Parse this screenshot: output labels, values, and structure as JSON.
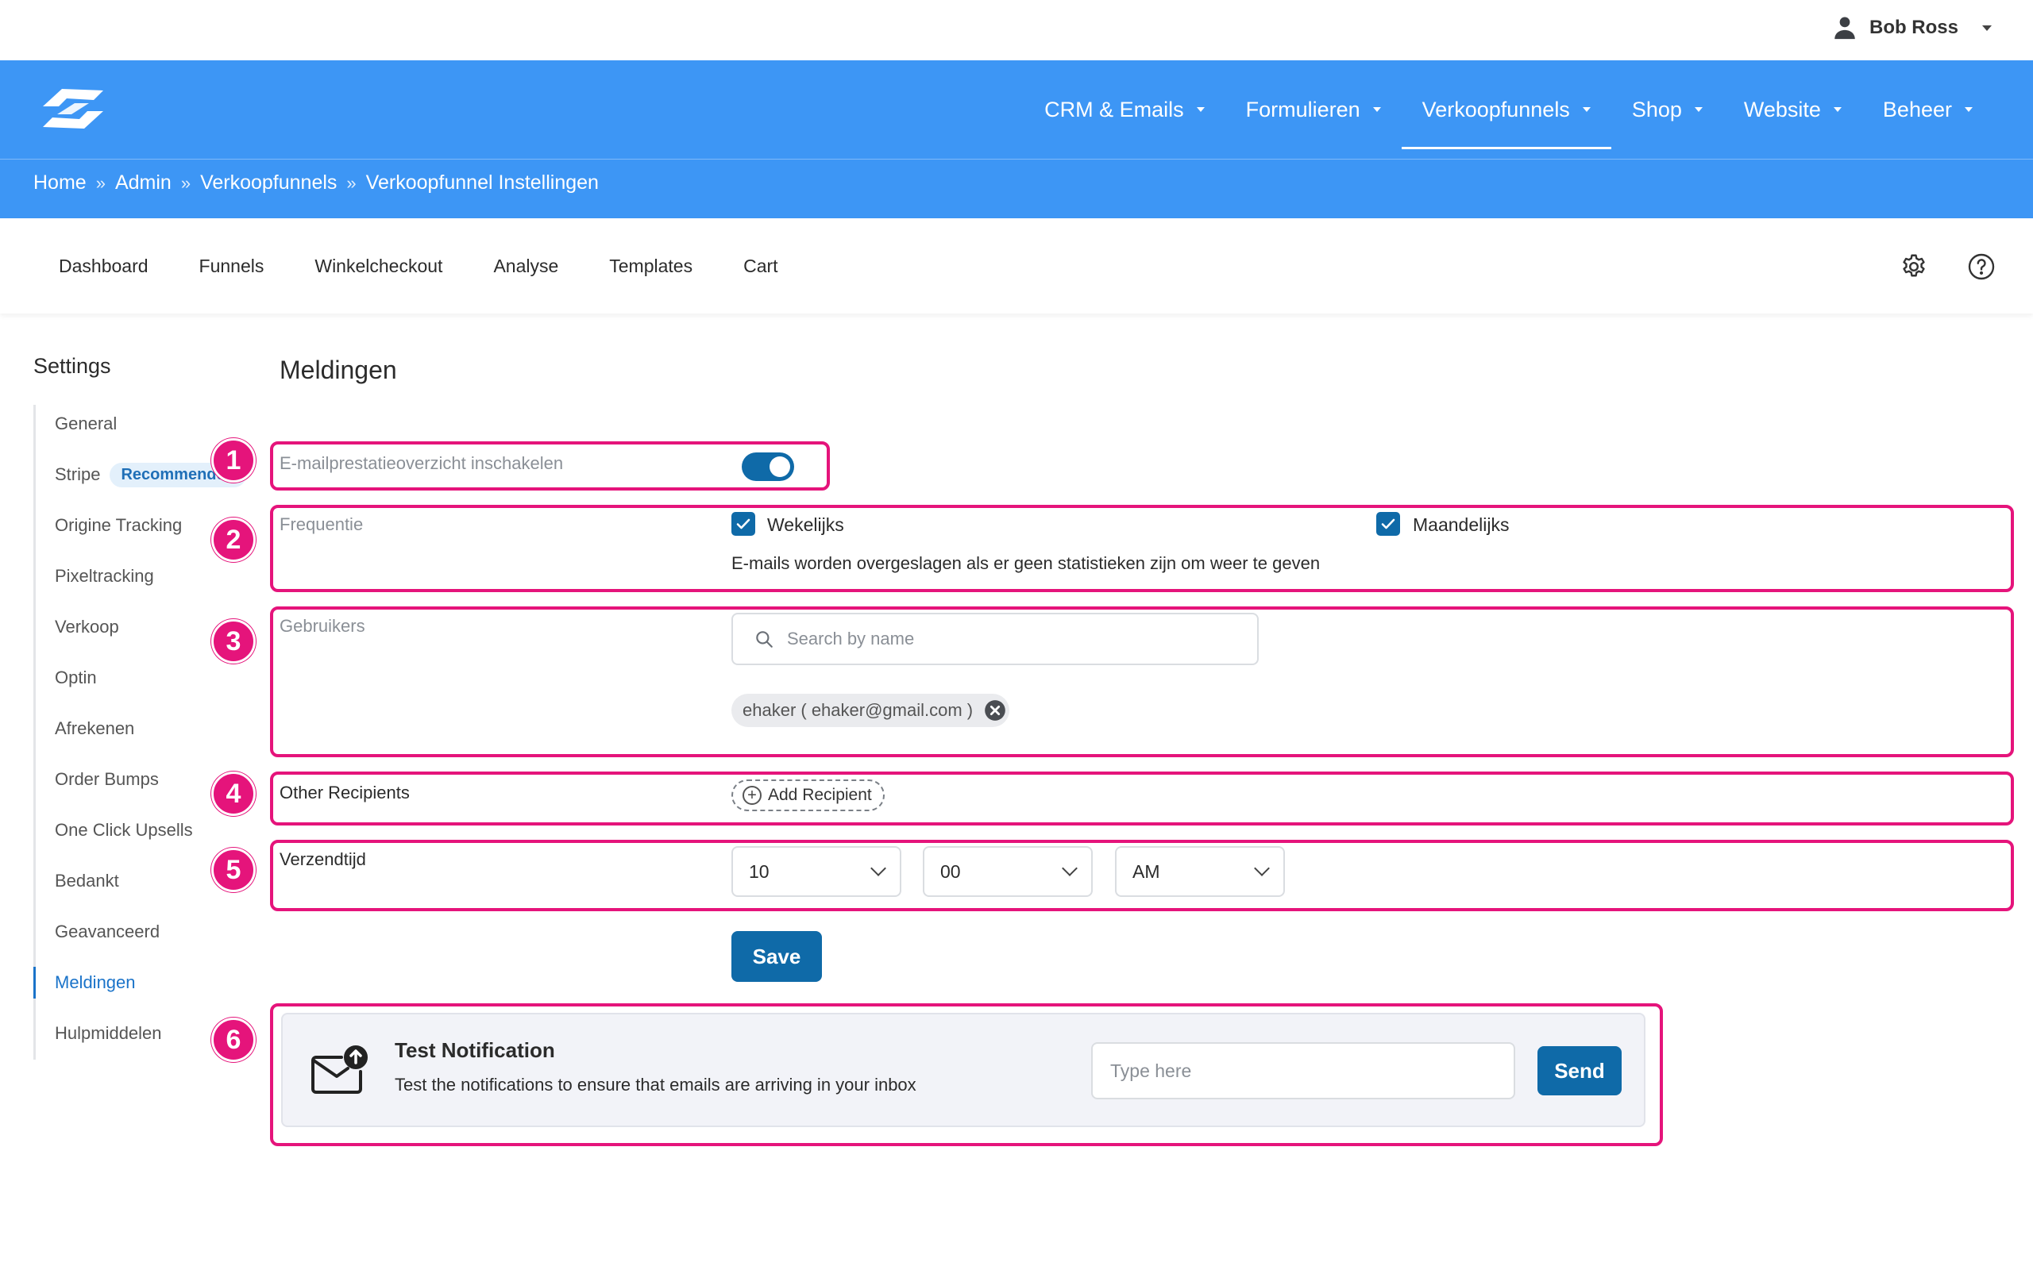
{
  "user": {
    "name": "Bob Ross"
  },
  "nav": {
    "items": [
      {
        "label": "CRM & Emails",
        "active": false
      },
      {
        "label": "Formulieren",
        "active": false
      },
      {
        "label": "Verkoopfunnels",
        "active": true
      },
      {
        "label": "Shop",
        "active": false
      },
      {
        "label": "Website",
        "active": false
      },
      {
        "label": "Beheer",
        "active": false
      }
    ]
  },
  "breadcrumb": {
    "items": [
      "Home",
      "Admin",
      "Verkoopfunnels",
      "Verkoopfunnel Instellingen"
    ],
    "separator": "»"
  },
  "subnav": {
    "tabs": [
      "Dashboard",
      "Funnels",
      "Winkelcheckout",
      "Analyse",
      "Templates",
      "Cart"
    ],
    "icons": [
      "gear-icon",
      "help-icon"
    ]
  },
  "sidebar": {
    "title": "Settings",
    "items": [
      {
        "label": "General"
      },
      {
        "label": "Stripe",
        "badge": "Recommended"
      },
      {
        "label": "Origine Tracking"
      },
      {
        "label": "Pixeltracking"
      },
      {
        "label": "Verkoop"
      },
      {
        "label": "Optin"
      },
      {
        "label": "Afrekenen"
      },
      {
        "label": "Order Bumps"
      },
      {
        "label": "One Click Upsells"
      },
      {
        "label": "Bedankt"
      },
      {
        "label": "Geavanceerd"
      },
      {
        "label": "Meldingen",
        "active": true
      },
      {
        "label": "Hulpmiddelen"
      }
    ]
  },
  "main": {
    "title": "Meldingen",
    "callout_numbers": [
      "1",
      "2",
      "3",
      "4",
      "5",
      "6"
    ],
    "email_overview": {
      "label": "E-mailprestatieoverzicht inschakelen",
      "enabled": true
    },
    "frequency": {
      "label": "Frequentie",
      "options": [
        {
          "label": "Wekelijks",
          "checked": true
        },
        {
          "label": "Maandelijks",
          "checked": true
        }
      ],
      "hint": "E-mails worden overgeslagen als er geen statistieken zijn om weer te geven"
    },
    "users": {
      "label": "Gebruikers",
      "search_placeholder": "Search by name",
      "selected": [
        "ehaker ( ehaker@gmail.com )"
      ]
    },
    "other_recipients": {
      "label": "Other Recipients",
      "add_label": "Add Recipient"
    },
    "send_time": {
      "label": "Verzendtijd",
      "hour": "10",
      "minute": "00",
      "period": "AM"
    },
    "save_label": "Save",
    "test": {
      "title": "Test Notification",
      "description": "Test the notifications to ensure that emails are arriving in your inbox",
      "placeholder": "Type here",
      "send_label": "Send"
    }
  },
  "colors": {
    "header_blue": "#3d96f5",
    "primary": "#0f6aa8",
    "callout": "#e5147b",
    "sidebar_active": "#1a73c9"
  }
}
